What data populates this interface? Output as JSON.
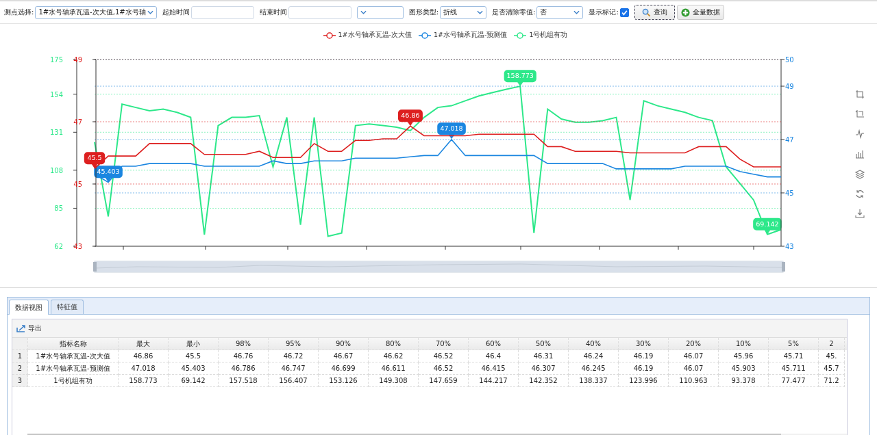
{
  "toolbar": {
    "fields": [
      {
        "kind": "select",
        "label": "测点选择:",
        "value": "1#水号轴承瓦温-次大值,1#水号轴"
      },
      {
        "kind": "input",
        "label": "起始时间"
      },
      {
        "kind": "input",
        "label": "结束时间"
      },
      {
        "kind": "select"
      },
      {
        "kind": "select",
        "label": "图形类型:",
        "value": "折线"
      },
      {
        "kind": "select",
        "label": "是否清除零值:",
        "value": "否"
      },
      {
        "kind": "checkbox",
        "label": "显示标记:",
        "checked": true
      }
    ],
    "buttons": [
      {
        "kind": "search",
        "label": "查询"
      },
      {
        "kind": "add",
        "label": "全量数据"
      }
    ]
  },
  "chart": {
    "layers": [
      {
        "chart_data": {
          "type": "line",
          "grid": true,
          "categories": [
            null,
            null,
            null,
            null,
            null,
            null,
            null,
            null,
            null,
            null,
            null,
            null,
            null,
            null,
            null,
            null,
            null,
            null,
            null,
            null,
            null,
            null,
            null,
            null,
            null,
            null,
            null,
            null,
            null,
            null,
            null,
            null,
            null,
            null,
            null,
            null,
            null,
            null,
            null,
            null,
            null,
            null,
            null,
            null,
            null,
            null,
            null,
            null,
            null,
            null,
            null
          ],
          "ylim": [
            43,
            49
          ],
          "yticks": [
            43,
            45,
            47,
            49
          ],
          "series": [
            {
              "name": "1#水号轴承瓦温-次大值",
              "color": "#dd1f1f",
              "values": [
                45.5,
                45.9,
                45.9,
                45.9,
                46.3,
                46.3,
                46.3,
                46.3,
                45.95,
                45.95,
                45.95,
                45.95,
                46.05,
                45.85,
                45.85,
                45.85,
                46.3,
                46.05,
                46.05,
                46.4,
                46.4,
                46.45,
                46.45,
                46.86,
                46.55,
                46.55,
                46.55,
                46.55,
                46.6,
                46.6,
                46.6,
                46.6,
                46.6,
                46.2,
                46.2,
                46.05,
                46.05,
                46.05,
                46.05,
                46.0,
                46.0,
                46.0,
                46.0,
                46.0,
                46.2,
                46.2,
                46.2,
                45.8,
                45.55,
                45.55,
                45.55
              ]
            }
          ],
          "annotations": [
            {
              "y": 45.5,
              "text": "45.5"
            },
            {
              "y": 46.86,
              "text": "46.86"
            }
          ]
        }
      },
      {
        "chart_data": {
          "type": "line",
          "grid": true,
          "categories": [
            null,
            null,
            null,
            null,
            null,
            null,
            null,
            null,
            null,
            null,
            null,
            null,
            null,
            null,
            null,
            null,
            null,
            null,
            null,
            null,
            null,
            null,
            null,
            null,
            null,
            null,
            null,
            null,
            null,
            null,
            null,
            null,
            null,
            null,
            null,
            null,
            null,
            null,
            null,
            null,
            null,
            null,
            null,
            null,
            null,
            null,
            null,
            null,
            null,
            null,
            null
          ],
          "ylim": [
            43,
            50
          ],
          "yticks": [
            43,
            45,
            47,
            49,
            50
          ],
          "series": [
            {
              "name": "1#水号轴承瓦温-预测值",
              "color": "#1b86e0",
              "values": [
                45.7,
                45.4,
                46.0,
                46.0,
                46.1,
                46.1,
                46.1,
                46.1,
                46.0,
                46.0,
                46.0,
                46.0,
                46.0,
                46.2,
                46.1,
                46.1,
                46.2,
                46.2,
                46.2,
                46.3,
                46.3,
                46.3,
                46.3,
                46.35,
                46.4,
                46.4,
                47.0,
                46.4,
                46.4,
                46.4,
                46.4,
                46.4,
                46.4,
                46.1,
                46.1,
                46.1,
                46.1,
                46.1,
                45.9,
                45.9,
                45.9,
                45.9,
                45.9,
                46.0,
                46.0,
                46.0,
                46.0,
                45.8,
                45.7,
                45.6,
                45.6
              ]
            }
          ],
          "annotations": [
            {
              "y": 45.403,
              "text": "45.403"
            },
            {
              "y": 47.018,
              "text": "47.018"
            }
          ]
        }
      },
      {
        "chart_data": {
          "type": "line",
          "grid": true,
          "categories": [
            null,
            null,
            null,
            null,
            null,
            null,
            null,
            null,
            null,
            null,
            null,
            null,
            null,
            null,
            null,
            null,
            null,
            null,
            null,
            null,
            null,
            null,
            null,
            null,
            null,
            null,
            null,
            null,
            null,
            null,
            null,
            null,
            null,
            null,
            null,
            null,
            null,
            null,
            null,
            null,
            null,
            null,
            null,
            null,
            null,
            null,
            null,
            null,
            null,
            null,
            null
          ],
          "ylim": [
            62,
            175
          ],
          "yticks": [
            62,
            85,
            108,
            131,
            154,
            175
          ],
          "series": [
            {
              "name": "1号机组有功",
              "color": "#2de88a",
              "values": [
                125,
                80,
                148,
                146,
                144,
                145,
                143,
                140,
                69,
                135,
                140,
                140,
                141,
                110,
                140,
                75,
                140,
                68,
                70,
                135,
                136,
                135,
                134,
                132,
                140,
                146,
                147,
                150,
                153,
                155,
                157,
                158.8,
                70,
                145,
                139,
                137,
                137,
                138,
                140,
                90,
                150,
                147,
                145,
                143,
                140,
                138,
                110,
                100,
                90,
                69.1,
                72
              ]
            }
          ],
          "annotations": [
            {
              "y": 158.773,
              "text": "158.773"
            },
            {
              "y": 69.142,
              "text": "69.142"
            }
          ]
        }
      }
    ],
    "zoom_slider": {
      "level": 1
    }
  },
  "bottom": {
    "tabs": [
      {
        "label": "数据视图",
        "selected": true
      },
      {
        "label": "特征值",
        "selected": false
      }
    ],
    "export": "导出",
    "table": {
      "columns": [
        "指标名称",
        "最大",
        "最小",
        "98%",
        "95%",
        "90%",
        "80%",
        "70%",
        "60%",
        "50%",
        "40%",
        "30%",
        "20%",
        "10%",
        "5%",
        "2"
      ],
      "rows": [
        {
          "index": "1",
          "cells": [
            "1#水号轴承瓦温-次大值",
            "46.86",
            "45.5",
            "46.76",
            "46.72",
            "46.67",
            "46.62",
            "46.52",
            "46.4",
            "46.31",
            "46.24",
            "46.19",
            "46.07",
            "45.96",
            "45.71",
            "45."
          ]
        },
        {
          "index": "2",
          "cells": [
            "1#水号轴承瓦温-预测值",
            "47.018",
            "45.403",
            "46.786",
            "46.747",
            "46.699",
            "46.611",
            "46.52",
            "46.415",
            "46.307",
            "46.245",
            "46.19",
            "46.07",
            "45.903",
            "45.711",
            "45.7"
          ]
        },
        {
          "index": "3",
          "cells": [
            "1号机组有功",
            "158.773",
            "69.142",
            "157.518",
            "156.407",
            "153.126",
            "149.308",
            "147.659",
            "144.217",
            "142.352",
            "138.337",
            "123.996",
            "110.963",
            "93.378",
            "77.477",
            "71.2"
          ]
        }
      ]
    }
  }
}
